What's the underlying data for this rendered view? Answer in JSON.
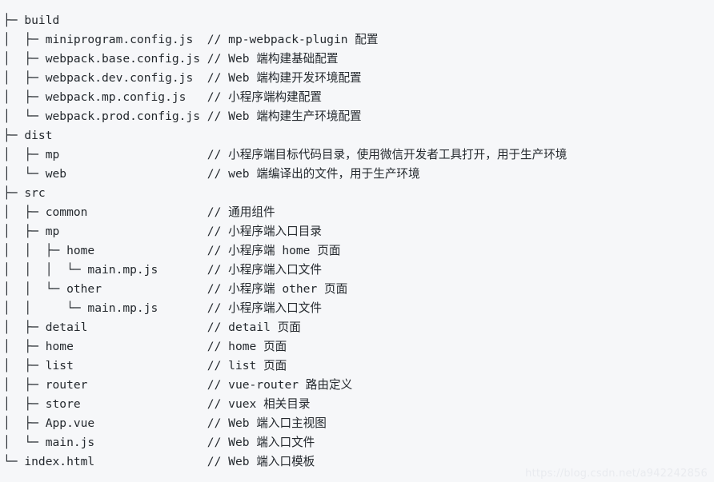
{
  "colors": {
    "background": "#f6f7f9",
    "text": "#24292e",
    "watermark": "#e9ebef"
  },
  "tree": {
    "title": "project-directory-tree",
    "lines": [
      "├─ build",
      "│  ├─ miniprogram.config.js  // mp-webpack-plugin 配置",
      "│  ├─ webpack.base.config.js // Web 端构建基础配置",
      "│  ├─ webpack.dev.config.js  // Web 端构建开发环境配置",
      "│  ├─ webpack.mp.config.js   // 小程序端构建配置",
      "│  └─ webpack.prod.config.js // Web 端构建生产环境配置",
      "├─ dist",
      "│  ├─ mp                     // 小程序端目标代码目录，使用微信开发者工具打开，用于生产环境",
      "│  └─ web                    // web 端编译出的文件，用于生产环境",
      "├─ src",
      "│  ├─ common                 // 通用组件",
      "│  ├─ mp                     // 小程序端入口目录",
      "│  │  ├─ home                // 小程序端 home 页面",
      "│  │  │  └─ main.mp.js       // 小程序端入口文件",
      "│  │  └─ other               // 小程序端 other 页面",
      "│  │     └─ main.mp.js       // 小程序端入口文件",
      "│  ├─ detail                 // detail 页面",
      "│  ├─ home                   // home 页面",
      "│  ├─ list                   // list 页面",
      "│  ├─ router                 // vue-router 路由定义",
      "│  ├─ store                  // vuex 相关目录",
      "│  ├─ App.vue                // Web 端入口主视图",
      "│  └─ main.js                // Web 端入口文件",
      "└─ index.html                // Web 端入口模板"
    ]
  },
  "watermark": {
    "text": "https://blog.csdn.net/a942242856"
  }
}
